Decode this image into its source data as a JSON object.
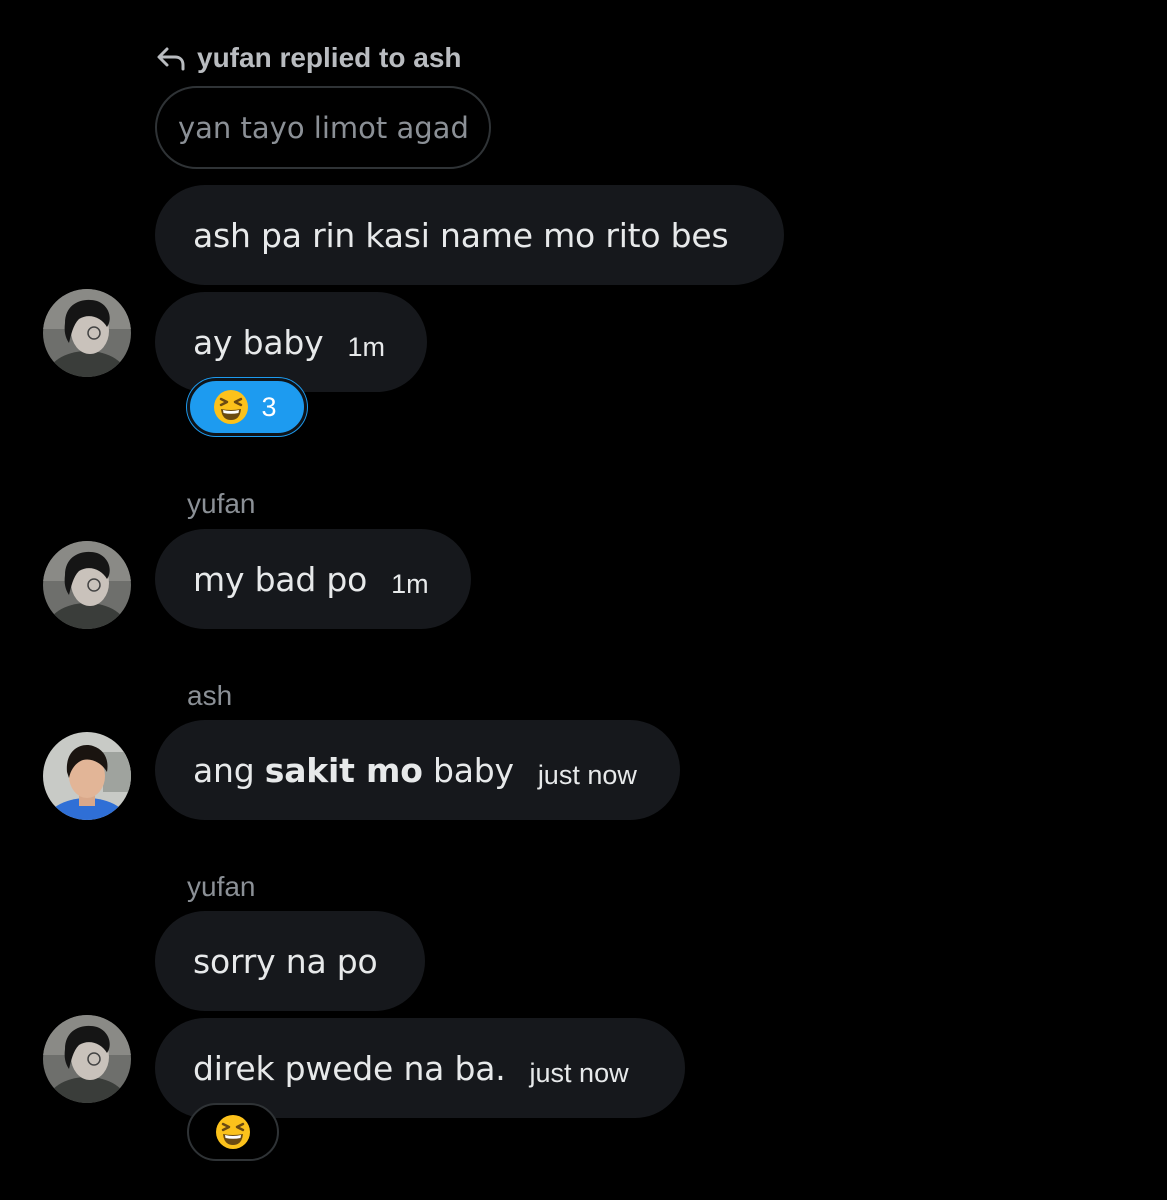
{
  "reply_context": {
    "label": "yufan replied to ash",
    "icon": "reply-arrow-icon",
    "quoted_text": "yan tayo limot agad"
  },
  "messages": [
    {
      "sender": "",
      "text": "ash pa rin kasi name mo rito bes",
      "time": ""
    },
    {
      "sender": "",
      "text": "ay baby",
      "time": "1m",
      "avatar": "yufan",
      "reaction": {
        "emoji": "grinning-squinting-face",
        "count": "3",
        "active": true
      }
    },
    {
      "sender": "yufan",
      "text": "my bad po",
      "time": "1m",
      "avatar": "yufan"
    },
    {
      "sender": "ash",
      "text_before": "ang ",
      "text_bold": "sakit mo",
      "text_after": " baby",
      "time": "just now",
      "avatar": "ash"
    },
    {
      "sender": "yufan",
      "text": "sorry na po",
      "time": ""
    },
    {
      "sender": "",
      "text": "direk pwede na ba.",
      "time": "just now",
      "avatar": "yufan",
      "reaction": {
        "emoji": "grinning-squinting-face",
        "count": "",
        "active": false
      }
    }
  ],
  "colors": {
    "background": "#000000",
    "bubble": "#16181c",
    "text": "#e7e9ea",
    "muted": "#8b9096",
    "reaction_active": "#1d9bf0",
    "border": "#2f3336"
  }
}
